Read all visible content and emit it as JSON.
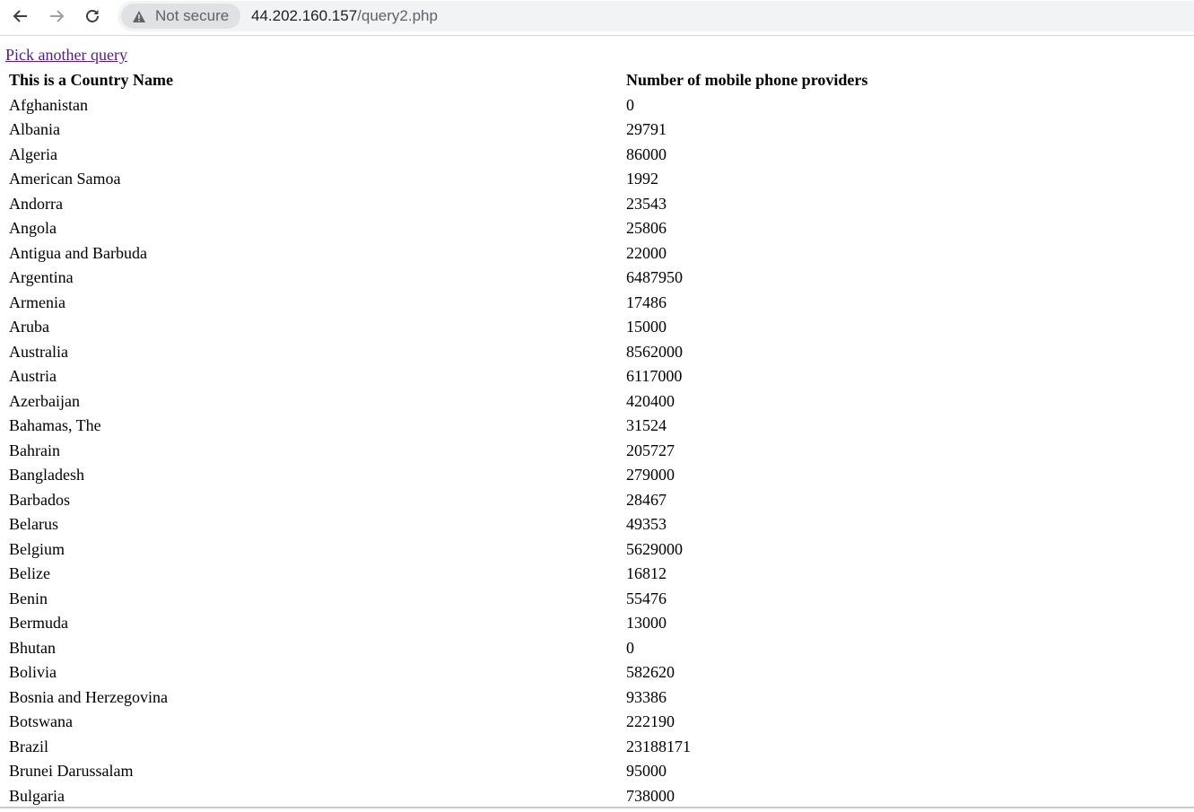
{
  "browser": {
    "security_label": "Not secure",
    "url_host": "44.202.160.157",
    "url_path": "/query2.php"
  },
  "page": {
    "link_text": "Pick another query",
    "headers": [
      "This is a Country Name",
      "Number of mobile phone providers"
    ],
    "rows": [
      [
        "Afghanistan",
        "0"
      ],
      [
        "Albania",
        "29791"
      ],
      [
        "Algeria",
        "86000"
      ],
      [
        "American Samoa",
        "1992"
      ],
      [
        "Andorra",
        "23543"
      ],
      [
        "Angola",
        "25806"
      ],
      [
        "Antigua and Barbuda",
        "22000"
      ],
      [
        "Argentina",
        "6487950"
      ],
      [
        "Armenia",
        "17486"
      ],
      [
        "Aruba",
        "15000"
      ],
      [
        "Australia",
        "8562000"
      ],
      [
        "Austria",
        "6117000"
      ],
      [
        "Azerbaijan",
        "420400"
      ],
      [
        "Bahamas, The",
        "31524"
      ],
      [
        "Bahrain",
        "205727"
      ],
      [
        "Bangladesh",
        "279000"
      ],
      [
        "Barbados",
        "28467"
      ],
      [
        "Belarus",
        "49353"
      ],
      [
        "Belgium",
        "5629000"
      ],
      [
        "Belize",
        "16812"
      ],
      [
        "Benin",
        "55476"
      ],
      [
        "Bermuda",
        "13000"
      ],
      [
        "Bhutan",
        "0"
      ],
      [
        "Bolivia",
        "582620"
      ],
      [
        "Bosnia and Herzegovina",
        "93386"
      ],
      [
        "Botswana",
        "222190"
      ],
      [
        "Brazil",
        "23188171"
      ],
      [
        "Brunei Darussalam",
        "95000"
      ],
      [
        "Bulgaria",
        "738000"
      ]
    ]
  }
}
